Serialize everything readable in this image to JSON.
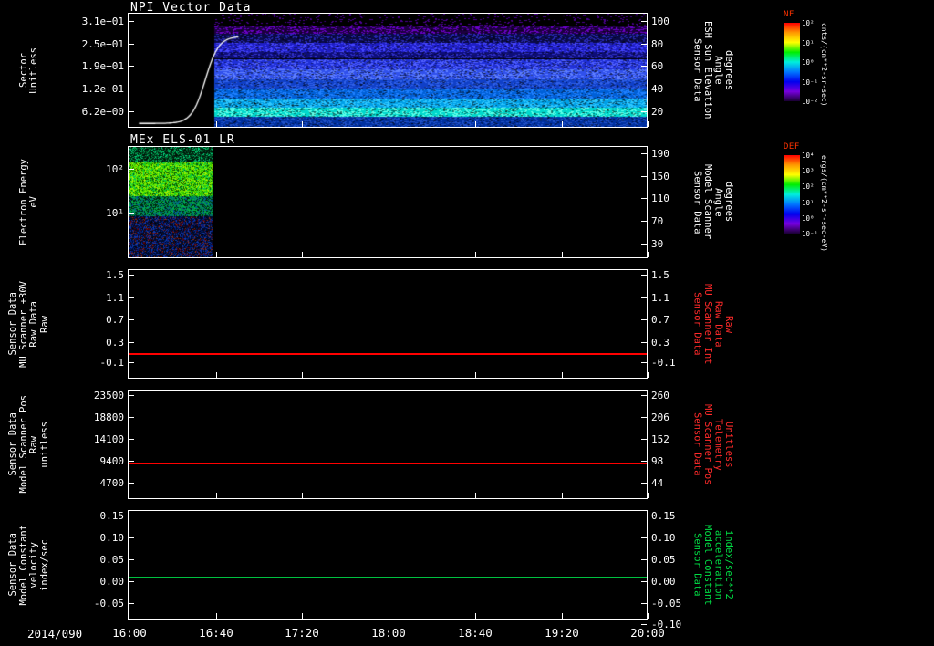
{
  "date_label": "2014/090",
  "x_axis": {
    "tick_labels": [
      "16:00",
      "16:40",
      "17:20",
      "18:00",
      "18:40",
      "19:20",
      "20:00"
    ],
    "range": [
      "16:00",
      "20:00"
    ]
  },
  "colors": {
    "background": "#000000",
    "axis": "#ffffff",
    "red_label": "#ff2a2a",
    "green_label": "#00dd44",
    "colorbar_title": "#ff3300"
  },
  "chart_data": [
    {
      "type": "heatmap",
      "title": "NPI Vector Data",
      "ylabel_lines": [
        "Sector",
        "Unitless"
      ],
      "right_label_lines": [
        "Sensor Data",
        "ESH Sun Elevation",
        "Angle",
        "degrees"
      ],
      "right_label_color": "#ffffff",
      "y_ticks": [
        {
          "label": "3.1e+01",
          "frac": 0.032
        },
        {
          "label": "2.5e+01",
          "frac": 0.23
        },
        {
          "label": "1.9e+01",
          "frac": 0.421
        },
        {
          "label": "1.2e+01",
          "frac": 0.619
        },
        {
          "label": "6.2e+00",
          "frac": 0.817
        }
      ],
      "right_ticks": [
        {
          "label": "100",
          "frac": 0.032
        },
        {
          "label": "80",
          "frac": 0.23
        },
        {
          "label": "60",
          "frac": 0.421
        },
        {
          "label": "40",
          "frac": 0.619
        },
        {
          "label": "20",
          "frac": 0.817
        }
      ],
      "colorbar": {
        "title": "NF",
        "tick_labels": [
          "10²",
          "10¹",
          "10⁰",
          "10⁻¹",
          "10⁻²"
        ],
        "unit": "cnts/(cm**2-sr-sec)",
        "gradient": [
          "#ff0000",
          "#ff9900",
          "#ffff00",
          "#00ee00",
          "#00eedd",
          "#0077ff",
          "#0000ee",
          "#7700dd",
          "#1a0033"
        ]
      },
      "heatmap": {
        "data_start_frac": 0.165,
        "bands": [
          {
            "y": 0.0,
            "h": 0.11,
            "base": "#000000",
            "speck": "#4a0090",
            "density": 0.12
          },
          {
            "y": 0.11,
            "h": 0.07,
            "base": "#1c0040",
            "speck": "#6a00c8",
            "density": 0.45
          },
          {
            "y": 0.18,
            "h": 0.08,
            "base": "#0a0a46",
            "speck": "#2828b4",
            "density": 0.4
          },
          {
            "y": 0.26,
            "h": 0.08,
            "base": "#1e1ec8",
            "speck": "#4646ff",
            "density": 0.45
          },
          {
            "y": 0.34,
            "h": 0.06,
            "base": "#0d0d78",
            "speck": "#3030c8",
            "density": 0.4
          },
          {
            "y": 0.4,
            "h": 0.09,
            "base": "#2030d8",
            "speck": "#5060ff",
            "density": 0.45
          },
          {
            "y": 0.49,
            "h": 0.09,
            "base": "#3050ec",
            "speck": "#6080ff",
            "density": 0.45
          },
          {
            "y": 0.58,
            "h": 0.08,
            "base": "#1040c8",
            "speck": "#3060e8",
            "density": 0.4
          },
          {
            "y": 0.66,
            "h": 0.09,
            "base": "#0060d8",
            "speck": "#2080ff",
            "density": 0.45
          },
          {
            "y": 0.75,
            "h": 0.08,
            "base": "#00a0e8",
            "speck": "#30c8ff",
            "density": 0.45
          },
          {
            "y": 0.83,
            "h": 0.08,
            "base": "#00d8cc",
            "speck": "#60ffe8",
            "density": 0.45
          },
          {
            "y": 0.91,
            "h": 0.09,
            "base": "#0030a0",
            "speck": "#2050c8",
            "density": 0.4
          }
        ]
      },
      "curve": {
        "color": "#ffffff",
        "x_start_frac": 0.02,
        "x_end_frac": 0.215,
        "x_mid_frac": 0.148,
        "steepness": 0.013,
        "y_bottom_frac": 0.97,
        "y_top_frac": 0.2
      }
    },
    {
      "type": "heatmap",
      "title": "MEx ELS-01 LR",
      "ylabel_lines": [
        "Electron Energy",
        "eV"
      ],
      "right_label_lines": [
        "Sensor Data",
        "Model Scanner",
        "Angle",
        "degrees"
      ],
      "right_label_color": "#ffffff",
      "y_ticks": [
        {
          "label": "10²",
          "frac": 0.163
        },
        {
          "label": "10¹",
          "frac": 0.553
        }
      ],
      "right_ticks": [
        {
          "label": "190",
          "frac": 0.024
        },
        {
          "label": "150",
          "frac": 0.228
        },
        {
          "label": "110",
          "frac": 0.423
        },
        {
          "label": "70",
          "frac": 0.626
        },
        {
          "label": "30",
          "frac": 0.829
        }
      ],
      "colorbar": {
        "title": "DEF",
        "tick_labels": [
          "10⁴",
          "10³",
          "10²",
          "10¹",
          "10⁰",
          "10⁻¹"
        ],
        "unit": "ergs/(cm**2-sr-sec-eV)",
        "gradient": [
          "#ff0000",
          "#ff9900",
          "#ffff00",
          "#00ee00",
          "#00eedd",
          "#0077ff",
          "#0000ee",
          "#7700dd",
          "#1a0033"
        ]
      },
      "noise": {
        "x_end_frac": 0.162,
        "rows": [
          {
            "f1": 0.14,
            "colors": [
              "#001408",
              "#00552a",
              "#00aa55",
              "#00e087"
            ],
            "weights": [
              0.45,
              0.25,
              0.2,
              0.1
            ]
          },
          {
            "f1": 0.44,
            "colors": [
              "#0a5500",
              "#2ecc00",
              "#7dee00",
              "#00cc55",
              "#baf500"
            ],
            "weights": [
              0.2,
              0.3,
              0.25,
              0.15,
              0.1
            ]
          },
          {
            "f1": 0.62,
            "colors": [
              "#00240f",
              "#008855",
              "#00bb44",
              "#005599"
            ],
            "weights": [
              0.35,
              0.3,
              0.2,
              0.15
            ]
          },
          {
            "f1": 1.01,
            "colors": [
              "#000a28",
              "#002080",
              "#103cb4",
              "#600000",
              "#903010",
              "#000000"
            ],
            "weights": [
              0.4,
              0.22,
              0.13,
              0.1,
              0.05,
              0.1
            ]
          }
        ]
      }
    },
    {
      "type": "line",
      "ylabel_lines": [
        "Sensor Data",
        "MU Scanner +30V",
        "Raw Data",
        "Raw"
      ],
      "right_label_lines": [
        "Sensor Data",
        "MU Scanner Int",
        "Raw Data",
        "Raw"
      ],
      "right_label_color": "#ff2a2a",
      "y_ticks": [
        {
          "label": "1.5",
          "frac": 0.01
        },
        {
          "label": "1.1",
          "frac": 0.215
        },
        {
          "label": "0.7",
          "frac": 0.42
        },
        {
          "label": "0.3",
          "frac": 0.625
        },
        {
          "label": "-0.1",
          "frac": 0.81
        }
      ],
      "right_ticks": [
        {
          "label": "1.5",
          "frac": 0.01
        },
        {
          "label": "1.1",
          "frac": 0.215
        },
        {
          "label": "0.7",
          "frac": 0.42
        },
        {
          "label": "0.3",
          "frac": 0.625
        },
        {
          "label": "-0.1",
          "frac": 0.81
        }
      ],
      "line": {
        "color": "#ff0000",
        "frac": 0.77,
        "value": 0.0
      }
    },
    {
      "type": "line",
      "ylabel_lines": [
        "Sensor Data",
        "Model Scanner Pos",
        "Raw",
        "unitless"
      ],
      "right_label_lines": [
        "Sensor Data",
        "MU Scanner Pos",
        "Telemetry",
        "Unitless"
      ],
      "right_label_color": "#ff2a2a",
      "y_ticks": [
        {
          "label": "23500",
          "frac": 0.008
        },
        {
          "label": "18800",
          "frac": 0.208
        },
        {
          "label": "14100",
          "frac": 0.408
        },
        {
          "label": "9400",
          "frac": 0.608
        },
        {
          "label": "4700",
          "frac": 0.808
        }
      ],
      "right_ticks": [
        {
          "label": "260",
          "frac": 0.008
        },
        {
          "label": "206",
          "frac": 0.208
        },
        {
          "label": "152",
          "frac": 0.408
        },
        {
          "label": "98",
          "frac": 0.608
        },
        {
          "label": "44",
          "frac": 0.808
        }
      ],
      "line": {
        "color": "#ff0000",
        "frac": 0.667,
        "value": 8000
      }
    },
    {
      "type": "line",
      "ylabel_lines": [
        "Sensor Data",
        "Model Constant",
        "velocity",
        "index/sec"
      ],
      "right_label_lines": [
        "Sensor Data",
        "Model Constant",
        "acceleration",
        "index/sec**2"
      ],
      "right_label_color": "#00dd44",
      "y_ticks": [
        {
          "label": "0.15",
          "frac": 0.008
        },
        {
          "label": "0.10",
          "frac": 0.208
        },
        {
          "label": "0.05",
          "frac": 0.408
        },
        {
          "label": "0.00",
          "frac": 0.608
        },
        {
          "label": "-0.05",
          "frac": 0.808
        }
      ],
      "right_ticks": [
        {
          "label": "0.15",
          "frac": 0.008
        },
        {
          "label": "0.10",
          "frac": 0.208
        },
        {
          "label": "0.05",
          "frac": 0.408
        },
        {
          "label": "0.00",
          "frac": 0.608
        },
        {
          "label": "-0.05",
          "frac": 0.808
        },
        {
          "label": "-0.10",
          "frac": 1.0
        }
      ],
      "line": {
        "color": "#00c040",
        "frac": 0.608,
        "value": 0.0
      }
    }
  ]
}
